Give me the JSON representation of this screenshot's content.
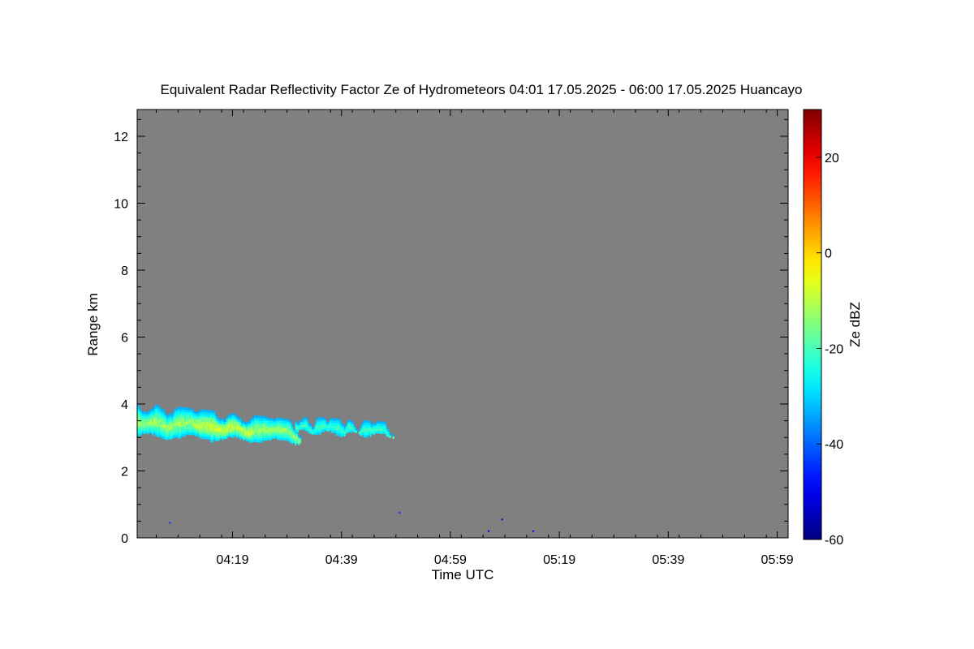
{
  "chart_data": {
    "type": "heatmap",
    "title": "Equivalent Radar Reflectivity Factor Ze of Hydrometeors   04:01 17.05.2025 - 06:00 17.05.2025 Huancayo",
    "xlabel": "Time UTC",
    "ylabel": "Range km",
    "x_tick_labels": [
      "04:19",
      "04:39",
      "04:59",
      "05:19",
      "05:39",
      "05:59"
    ],
    "x_ticks_minutes": [
      258,
      278,
      298,
      318,
      338,
      358
    ],
    "xlim_minutes": [
      240.5,
      360
    ],
    "y_tick_labels": [
      "0",
      "2",
      "4",
      "6",
      "8",
      "10",
      "12"
    ],
    "y_ticks": [
      0,
      2,
      4,
      6,
      8,
      10,
      12
    ],
    "ylim": [
      0,
      12.8
    ],
    "colorbar": {
      "label": "Ze dBZ",
      "tick_labels": [
        "-60",
        "-40",
        "-20",
        "0",
        "20"
      ],
      "ticks": [
        -60,
        -40,
        -20,
        0,
        20
      ],
      "range": [
        -60,
        30
      ],
      "colormap": "jet"
    },
    "background_color": "#808080",
    "echo_layers": [
      {
        "start_min": 240.5,
        "end_min": 270.4,
        "base_km": 2.9,
        "top_km": 4.05,
        "ze_min_dbz": -33,
        "ze_max_dbz": -8
      },
      {
        "start_min": 269.5,
        "end_min": 287.4,
        "base_km": 3.1,
        "top_km": 3.65,
        "ze_min_dbz": -33,
        "ze_max_dbz": -18
      }
    ],
    "speckles": [
      {
        "t_min": 246.5,
        "range_km": 0.45,
        "ze_dbz": -45
      },
      {
        "t_min": 288.7,
        "range_km": 0.75,
        "ze_dbz": -45
      },
      {
        "t_min": 305.0,
        "range_km": 0.2,
        "ze_dbz": -50
      },
      {
        "t_min": 307.5,
        "range_km": 0.55,
        "ze_dbz": -50
      },
      {
        "t_min": 313.2,
        "range_km": 0.2,
        "ze_dbz": -50
      }
    ]
  }
}
